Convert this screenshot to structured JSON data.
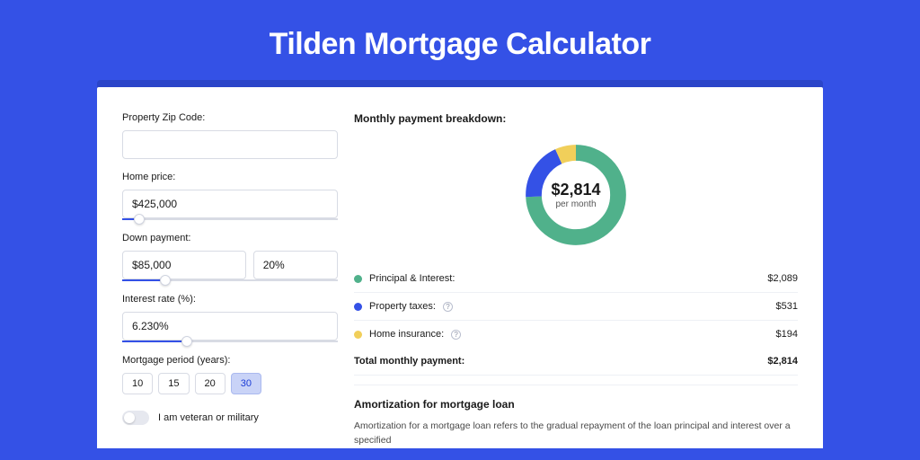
{
  "title": "Tilden Mortgage Calculator",
  "form": {
    "zip": {
      "label": "Property Zip Code:",
      "value": ""
    },
    "home_price": {
      "label": "Home price:",
      "value": "$425,000",
      "slider_pct": 8
    },
    "down_payment": {
      "label": "Down payment:",
      "amount": "$85,000",
      "pct": "20%",
      "slider_pct": 20
    },
    "interest_rate": {
      "label": "Interest rate (%):",
      "value": "6.230%",
      "slider_pct": 30
    },
    "period": {
      "label": "Mortgage period (years):",
      "options": [
        "10",
        "15",
        "20",
        "30"
      ],
      "active_index": 3
    },
    "veteran": {
      "label": "I am veteran or military",
      "checked": false
    }
  },
  "breakdown": {
    "title": "Monthly payment breakdown:",
    "total_amount": "$2,814",
    "total_sub": "per month",
    "items": [
      {
        "label": "Principal & Interest:",
        "value": "$2,089",
        "color": "#50b18b",
        "help": false
      },
      {
        "label": "Property taxes:",
        "value": "$531",
        "color": "#3451e6",
        "help": true
      },
      {
        "label": "Home insurance:",
        "value": "$194",
        "color": "#f1cf5a",
        "help": true
      }
    ],
    "total_row": {
      "label": "Total monthly payment:",
      "value": "$2,814"
    }
  },
  "amortization": {
    "title": "Amortization for mortgage loan",
    "text": "Amortization for a mortgage loan refers to the gradual repayment of the loan principal and interest over a specified"
  },
  "chart_data": {
    "type": "pie",
    "title": "Monthly payment breakdown",
    "series": [
      {
        "name": "Principal & Interest",
        "value": 2089,
        "color": "#50b18b"
      },
      {
        "name": "Property taxes",
        "value": 531,
        "color": "#3451e6"
      },
      {
        "name": "Home insurance",
        "value": 194,
        "color": "#f1cf5a"
      }
    ],
    "total": 2814,
    "center_label": "$2,814",
    "center_sub": "per month"
  }
}
